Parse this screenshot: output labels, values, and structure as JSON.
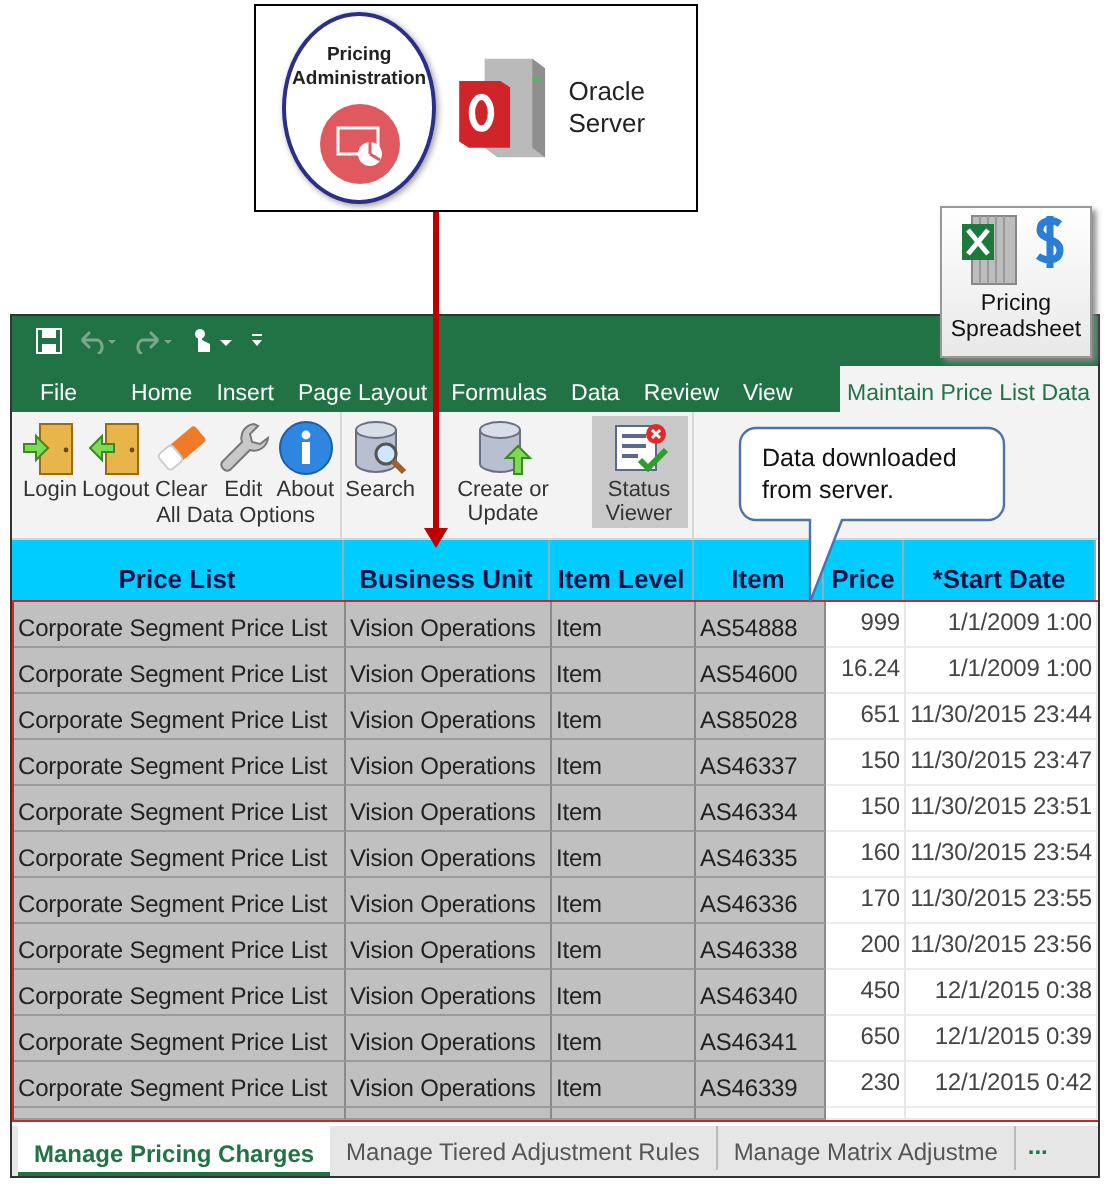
{
  "diagram": {
    "app_badge": {
      "label": "Pricing Administration"
    },
    "server": {
      "label": "Oracle Server"
    },
    "callout": "Data downloaded from server."
  },
  "add_in": {
    "label": "Pricing Spreadsheet"
  },
  "ribbon_tabs": [
    {
      "label": "File",
      "selected": false
    },
    {
      "label": "Home",
      "selected": false
    },
    {
      "label": "Insert",
      "selected": false
    },
    {
      "label": "Page Layout",
      "selected": false
    },
    {
      "label": "Formulas",
      "selected": false
    },
    {
      "label": "Data",
      "selected": false
    },
    {
      "label": "Review",
      "selected": false
    },
    {
      "label": "View",
      "selected": false
    },
    {
      "label": "Maintain Price List Data",
      "selected": true
    }
  ],
  "ribbon_groups": [
    {
      "label": "All Data Options",
      "buttons": [
        {
          "kind": "login",
          "label": "Login",
          "pressed": false
        },
        {
          "kind": "logout",
          "label": "Logout",
          "pressed": false
        },
        {
          "kind": "clear",
          "label": "Clear",
          "pressed": false
        },
        {
          "kind": "edit",
          "label": "Edit",
          "pressed": false
        },
        {
          "kind": "about",
          "label": "About",
          "pressed": false
        }
      ]
    },
    {
      "buttons": [
        {
          "kind": "search",
          "label": "Search",
          "pressed": false
        },
        {
          "kind": "create",
          "label": "Create or Update",
          "pressed": false
        },
        {
          "kind": "status",
          "label": "Status Viewer",
          "pressed": true
        }
      ]
    }
  ],
  "table": {
    "columns": [
      {
        "label": "Price List",
        "kind": "text",
        "read_only": true
      },
      {
        "label": "Business Unit",
        "kind": "text",
        "read_only": true
      },
      {
        "label": "Item Level",
        "kind": "text",
        "read_only": true
      },
      {
        "label": "Item",
        "kind": "text",
        "read_only": true
      },
      {
        "label": "Price",
        "kind": "number",
        "read_only": false
      },
      {
        "label": "*Start Date",
        "kind": "number",
        "read_only": false
      }
    ],
    "rows": [
      [
        "Corporate Segment Price List",
        "Vision Operations",
        "Item",
        "AS54888",
        "999",
        "1/1/2009 1:00"
      ],
      [
        "Corporate Segment Price List",
        "Vision Operations",
        "Item",
        "AS54600",
        "16.24",
        "1/1/2009 1:00"
      ],
      [
        "Corporate Segment Price List",
        "Vision Operations",
        "Item",
        "AS85028",
        "651",
        "11/30/2015 23:44"
      ],
      [
        "Corporate Segment Price List",
        "Vision Operations",
        "Item",
        "AS46337",
        "150",
        "11/30/2015 23:47"
      ],
      [
        "Corporate Segment Price List",
        "Vision Operations",
        "Item",
        "AS46334",
        "150",
        "11/30/2015 23:51"
      ],
      [
        "Corporate Segment Price List",
        "Vision Operations",
        "Item",
        "AS46335",
        "160",
        "11/30/2015 23:54"
      ],
      [
        "Corporate Segment Price List",
        "Vision Operations",
        "Item",
        "AS46336",
        "170",
        "11/30/2015 23:55"
      ],
      [
        "Corporate Segment Price List",
        "Vision Operations",
        "Item",
        "AS46338",
        "200",
        "11/30/2015 23:56"
      ],
      [
        "Corporate Segment Price List",
        "Vision Operations",
        "Item",
        "AS46340",
        "450",
        "12/1/2015 0:38"
      ],
      [
        "Corporate Segment Price List",
        "Vision Operations",
        "Item",
        "AS46341",
        "650",
        "12/1/2015 0:39"
      ],
      [
        "Corporate Segment Price List",
        "Vision Operations",
        "Item",
        "AS46339",
        "230",
        "12/1/2015 0:42"
      ]
    ]
  },
  "sheet_tabs": [
    {
      "label": "Manage Pricing Charges",
      "selected": true
    },
    {
      "label": "Manage Tiered Adjustment Rules",
      "selected": false
    },
    {
      "label": "Manage Matrix Adjustme",
      "selected": false
    }
  ],
  "sheet_tabs_more": "..."
}
